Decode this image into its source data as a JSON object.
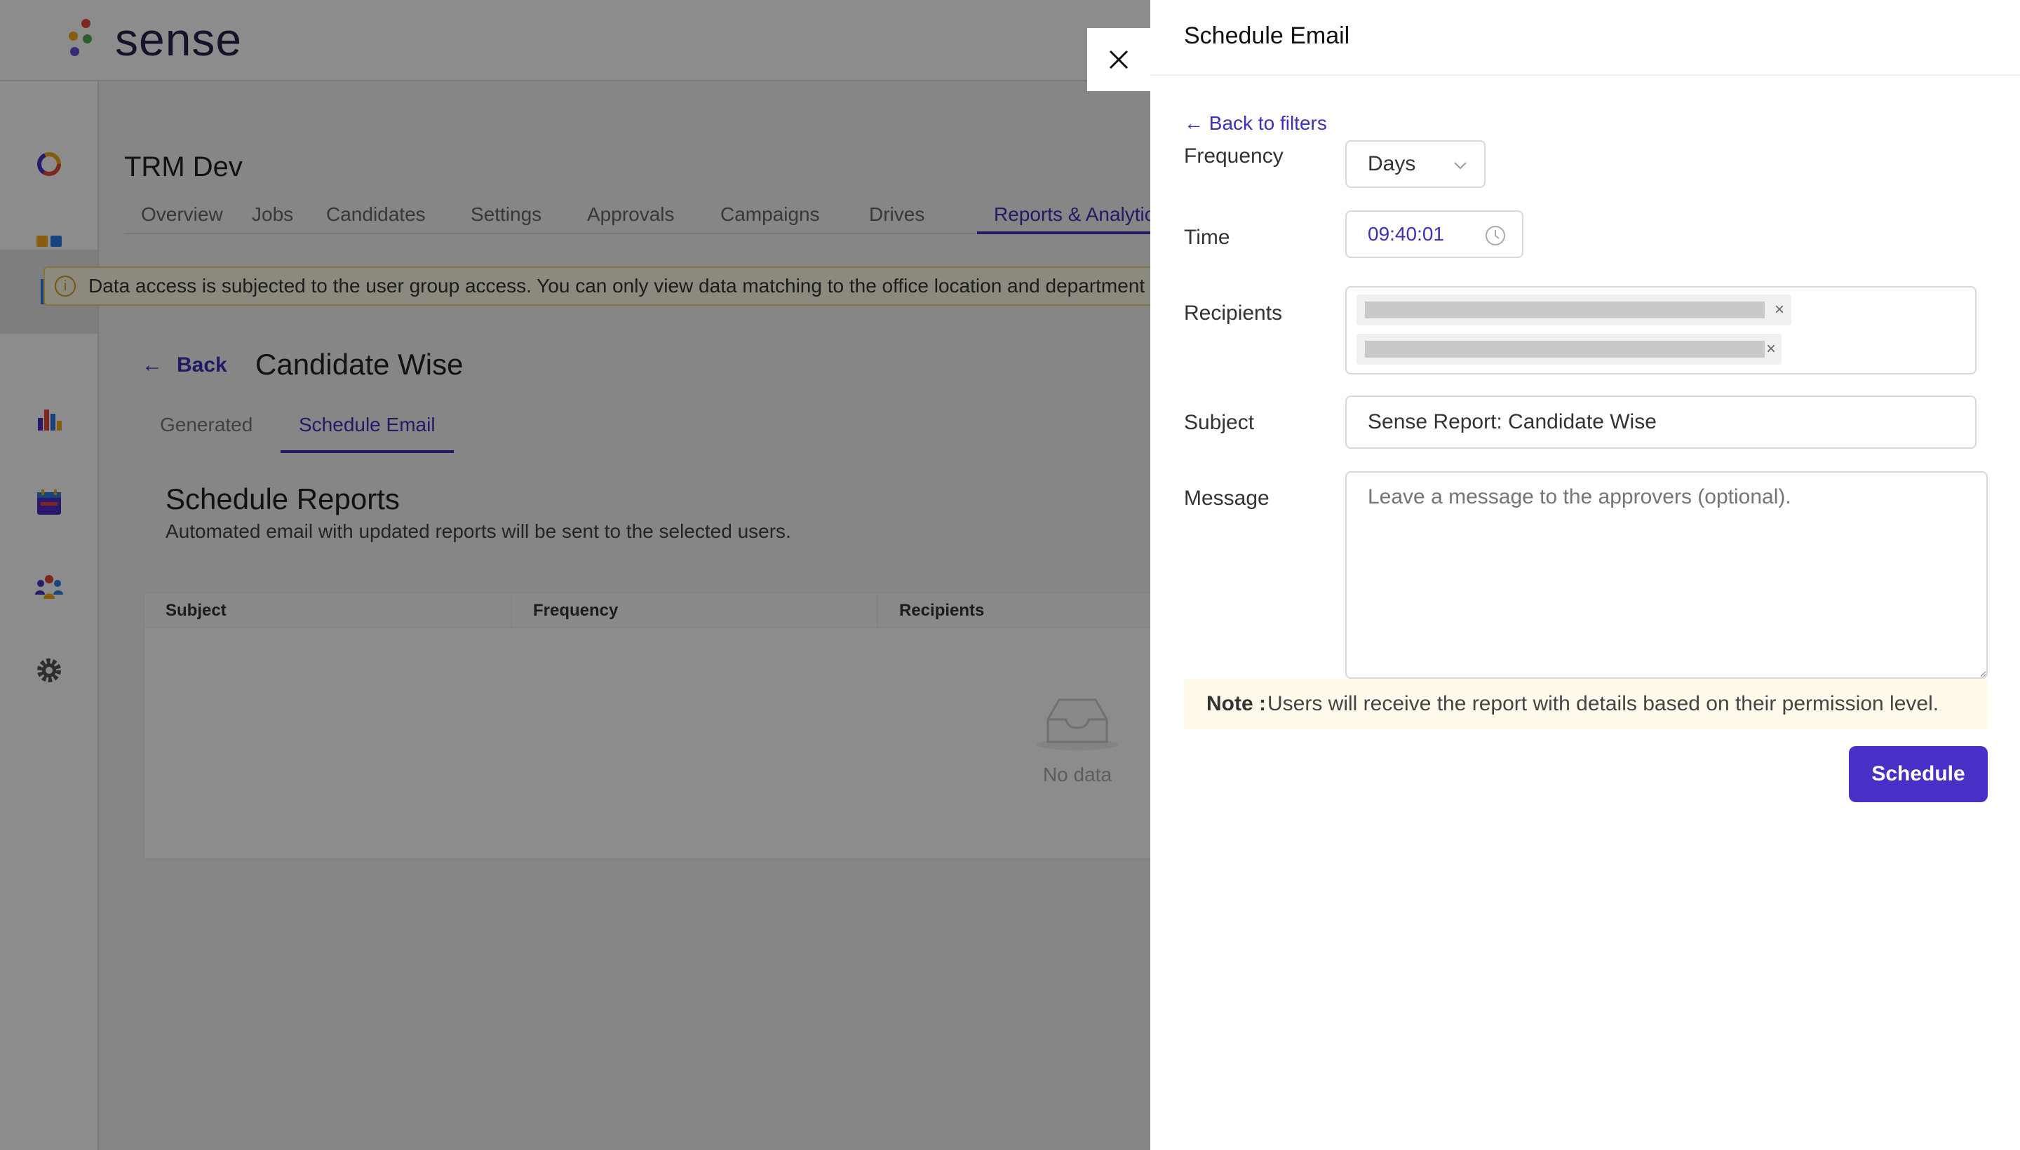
{
  "app": {
    "logo_text": "sense",
    "project_title": "TRM Dev",
    "nav_tabs": [
      "Overview",
      "Jobs",
      "Candidates",
      "Settings",
      "Approvals",
      "Campaigns",
      "Drives",
      "Reports & Analytics"
    ],
    "active_nav_tab": "Reports & Analytics",
    "sidebar_icons": [
      "analytics-ring-icon",
      "dashboard-grid-icon",
      "report-document-icon",
      "bar-chart-icon",
      "calendar-icon",
      "team-icon",
      "settings-gear-icon"
    ],
    "alert_text": "Data access is subjected to the user group access. You can only view data matching to the office location and department assigned to you.",
    "back_label": "Back",
    "page_title": "Candidate Wise",
    "sub_tabs": [
      "Generated",
      "Schedule Email"
    ],
    "active_sub_tab": "Schedule Email",
    "section_title": "Schedule Reports",
    "section_subtitle": "Automated email with updated reports will be sent to the selected users.",
    "table_headers": [
      "Subject",
      "Frequency",
      "Recipients"
    ],
    "empty_text": "No data"
  },
  "drawer": {
    "title": "Schedule Email",
    "back_to_filters": "Back to filters",
    "frequency_label": "Frequency",
    "frequency_value": "Days",
    "time_label": "Time",
    "time_value": "09:40:01",
    "recipients_label": "Recipients",
    "recipients": [
      "redacted-1",
      "redacted-2"
    ],
    "subject_label": "Subject",
    "subject_value": "Sense Report: Candidate Wise",
    "message_label": "Message",
    "message_placeholder": "Leave a message to the approvers (optional).",
    "note_prefix": "Note :",
    "note_text": "Users will receive the report with details based on their permission level.",
    "schedule_button": "Schedule"
  },
  "colors": {
    "accent": "#4a2fc7",
    "link": "#3b32b8",
    "overlay": "rgba(0,0,0,0.45)",
    "note_bg": "#fffaeb"
  }
}
